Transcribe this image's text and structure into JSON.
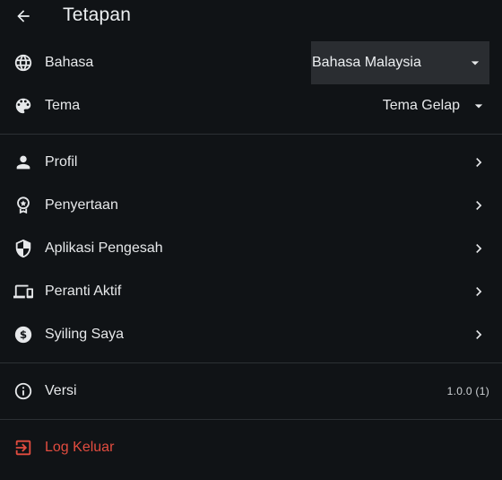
{
  "header": {
    "title": "Tetapan"
  },
  "colors": {
    "background": "#101316",
    "text": "#e6e8ea",
    "danger": "#e24c3f",
    "dropdown_bg": "#2a2d31"
  },
  "language": {
    "label": "Bahasa",
    "value": "Bahasa Malaysia",
    "icon": "globe-icon"
  },
  "theme": {
    "label": "Tema",
    "value": "Tema Gelap",
    "icon": "palette-icon"
  },
  "account_items": [
    {
      "label": "Profil",
      "icon": "person-icon"
    },
    {
      "label": "Penyertaan",
      "icon": "award-icon"
    },
    {
      "label": "Aplikasi Pengesah",
      "icon": "shield-icon"
    },
    {
      "label": "Peranti Aktif",
      "icon": "devices-icon"
    },
    {
      "label": "Syiling Saya",
      "icon": "coin-icon"
    }
  ],
  "version": {
    "label": "Versi",
    "value": "1.0.0 (1)",
    "icon": "info-icon"
  },
  "logout": {
    "label": "Log Keluar",
    "icon": "logout-icon"
  }
}
